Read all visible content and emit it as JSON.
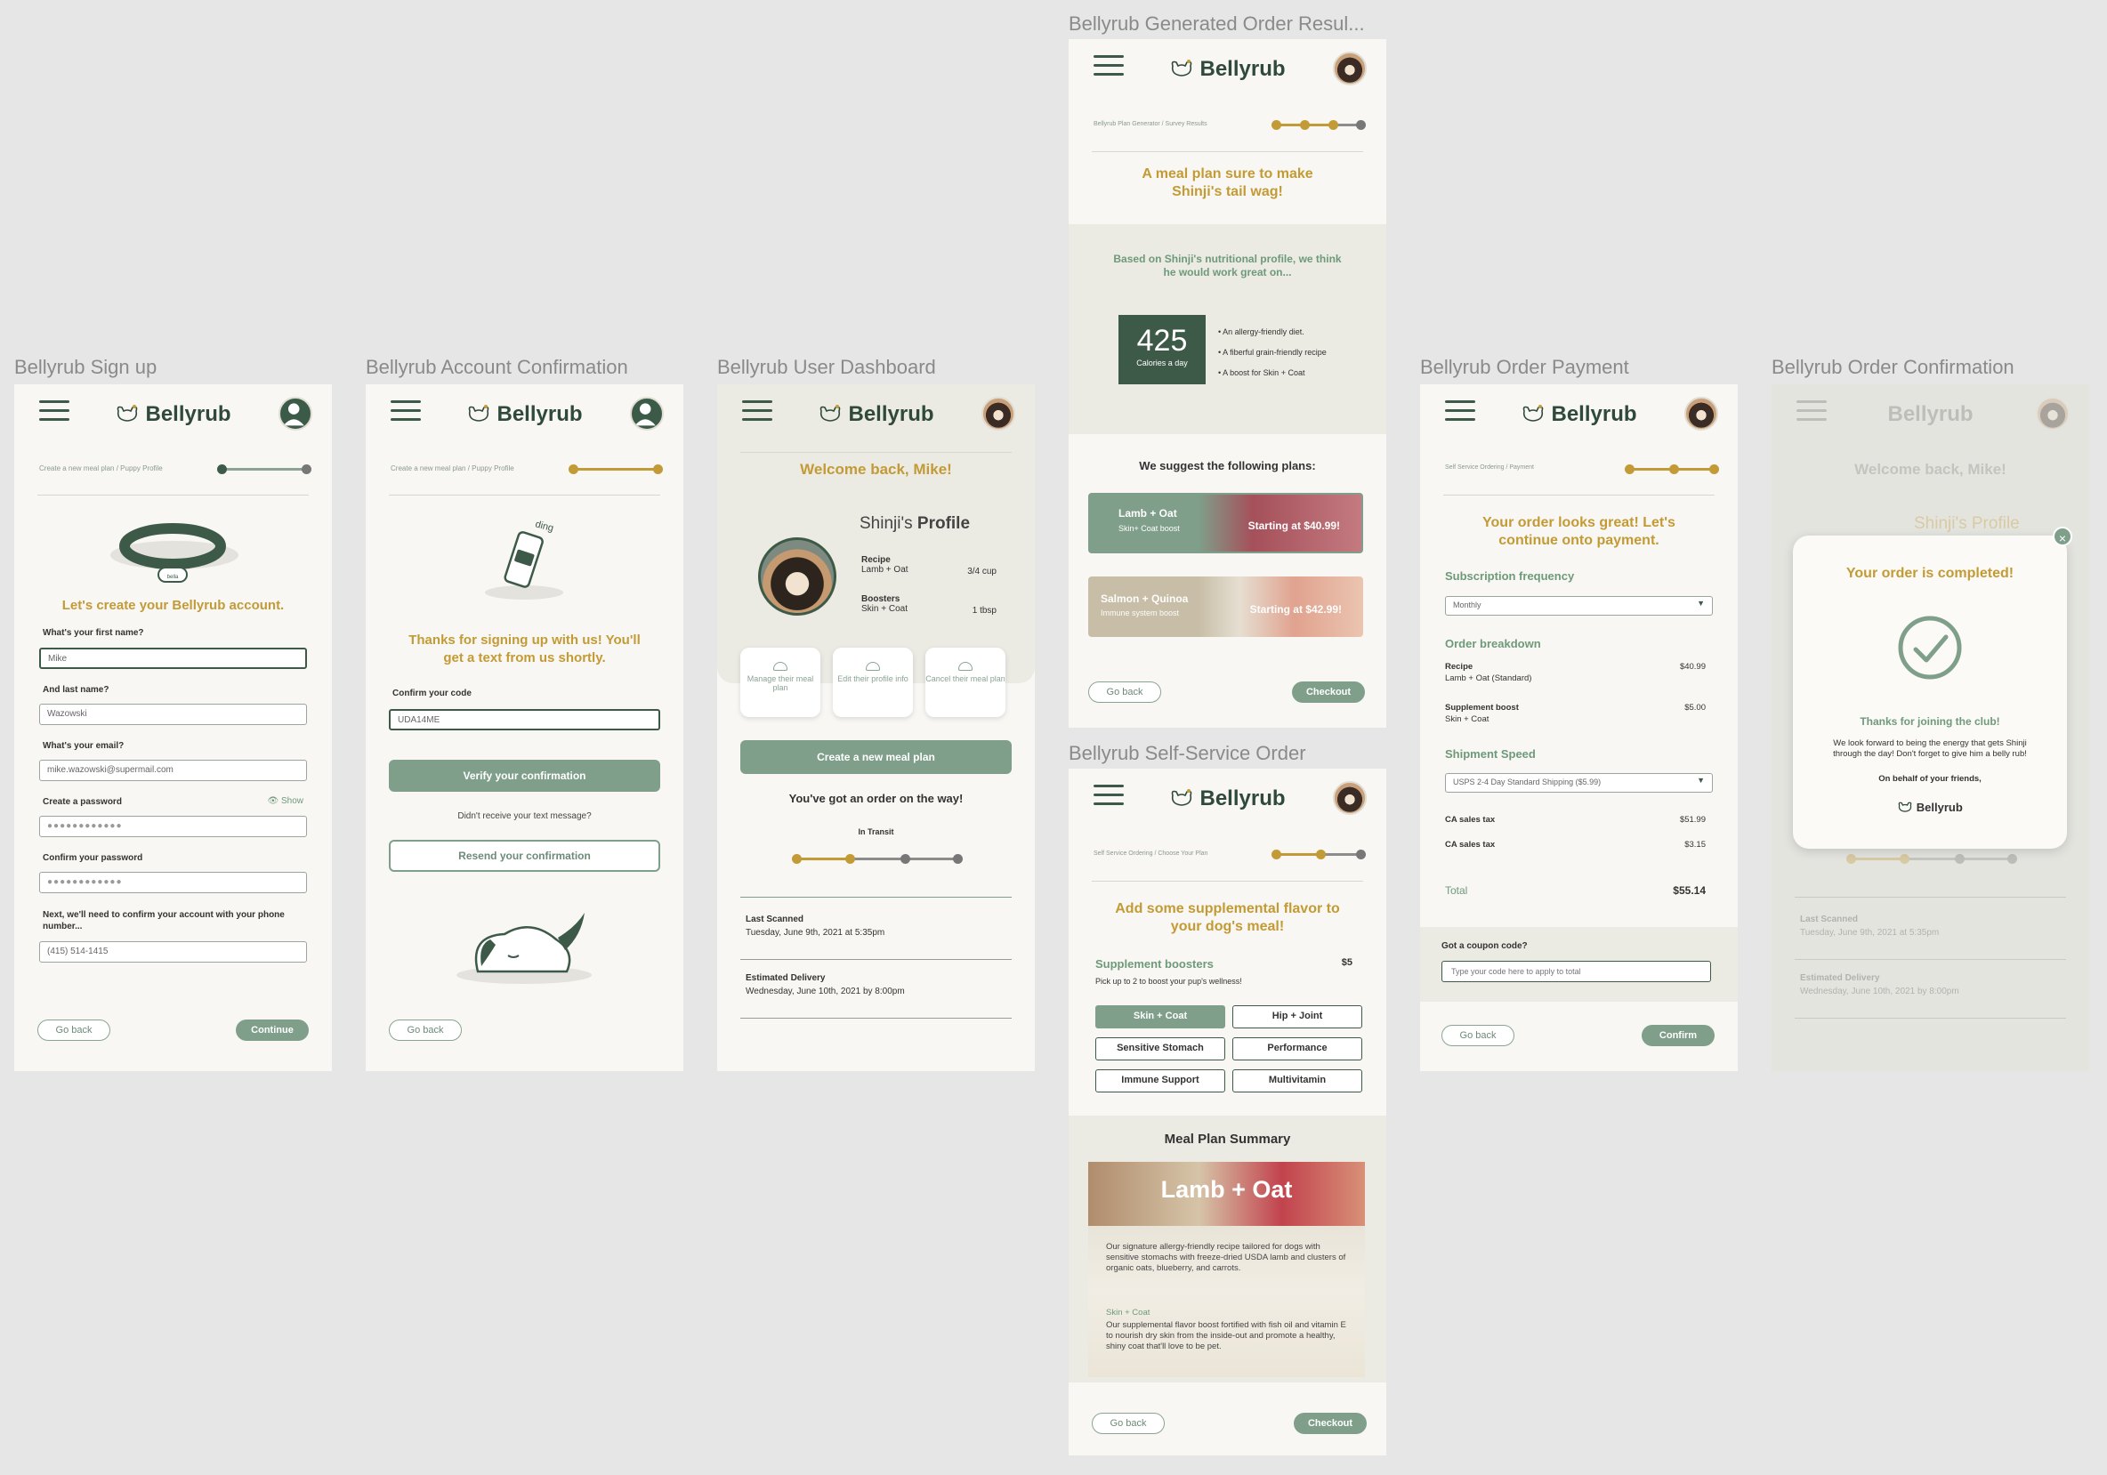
{
  "brand": {
    "name": "Bellyrub",
    "green": "#3d5a48",
    "gold": "#c39b36",
    "sage": "#7f9f8a"
  },
  "frames": {
    "signup": {
      "label": "Bellyrub Sign up",
      "crumb": "Create a new meal plan / Puppy Profile",
      "heading": "Let's create your Bellyrub account.",
      "first_label": "What's your first name?",
      "first_value": "Mike",
      "last_label": "And last name?",
      "last_value": "Wazowski",
      "email_label": "What's your email?",
      "email_value": "mike.wazowski@supermail.com",
      "pw_label": "Create a password",
      "pw_show": "Show",
      "pw_value": "●●●●●●●●●●●●",
      "pw2_label": "Confirm your password",
      "pw2_value": "●●●●●●●●●●●●",
      "phone_label": "Next, we'll need to confirm your account with your phone number...",
      "phone_value": "(415) 514-1415",
      "back": "Go back",
      "continue": "Continue",
      "collar_tag": "bella"
    },
    "confirm": {
      "label": "Bellyrub Account Confirmation",
      "crumb": "Create a new meal plan / Puppy Profile",
      "ding": "ding",
      "heading": "Thanks for signing up with us! You'll get a text from us shortly.",
      "code_label": "Confirm your code",
      "code_value": "UDA14ME",
      "verify": "Verify your confirmation",
      "didnt": "Didn't receive your text message?",
      "resend": "Resend your confirmation",
      "back": "Go back"
    },
    "dashboard": {
      "label": "Bellyrub User Dashboard",
      "welcome": "Welcome back, Mike!",
      "profile_name": "Shinji's",
      "profile_word": "Profile",
      "recipe_label": "Recipe",
      "recipe_value": "Lamb + Oat",
      "recipe_amt": "3/4 cup",
      "boosters_label": "Boosters",
      "boosters_value": "Skin + Coat",
      "boosters_amt": "1 tbsp",
      "tiles": [
        "Manage their meal plan",
        "Edit their profile info",
        "Cancel their meal plan"
      ],
      "create": "Create a new meal plan",
      "order_msg": "You've got an order on the way!",
      "status": "In Transit",
      "last_scanned_label": "Last Scanned",
      "last_scanned_value": "Tuesday, June 9th, 2021 at 5:35pm",
      "est_label": "Estimated Delivery",
      "est_value": "Wednesday, June 10th, 2021 by 8:00pm"
    },
    "results": {
      "label": "Bellyrub Generated Order Resul...",
      "crumb": "Bellyrub Plan Generator  / Survey Results",
      "heading": "A meal plan sure to make Shinji's tail wag!",
      "based": "Based on Shinji's nutritional profile, we think he would work great on...",
      "calories": "425",
      "calories_label": "Calories a day",
      "bullets": [
        "An allergy-friendly diet.",
        "A fiberful grain-friendly recipe",
        "A boost for Skin + Coat"
      ],
      "suggest": "We suggest the following plans:",
      "plans": [
        {
          "name": "Lamb + Oat",
          "sub": "Skin+ Coat boost",
          "price": "Starting at $40.99!"
        },
        {
          "name": "Salmon + Quinoa",
          "sub": "Immune system boost",
          "price": "Starting at $42.99!"
        }
      ],
      "back": "Go back",
      "checkout": "Checkout"
    },
    "selfservice": {
      "label": "Bellyrub Self-Service Order",
      "crumb": "Self Service Ordering / Choose Your Plan",
      "heading": "Add some supplemental flavor to your dog's meal!",
      "boost_title": "Supplement boosters",
      "boost_price": "$5",
      "boost_sub": "Pick up to 2 to boost your pup's wellness!",
      "options": [
        "Skin + Coat",
        "Hip + Joint",
        "Sensitive Stomach",
        "Performance",
        "Immune Support",
        "Multivitamin"
      ],
      "summary_title": "Meal Plan Summary",
      "plan_name": "Lamb + Oat",
      "plan_desc": "Our signature allergy-friendly recipe tailored for dogs with sensitive stomachs with freeze-dried USDA lamb and clusters of organic oats, blueberry, and carrots.",
      "boost_name": "Skin + Coat",
      "boost_desc": "Our supplemental flavor boost fortified with fish oil and vitamin E to nourish dry skin from the inside-out and promote a healthy, shiny coat that'll love to be pet.",
      "back": "Go back",
      "checkout": "Checkout"
    },
    "payment": {
      "label": "Bellyrub Order Payment",
      "crumb": "Self Service Ordering / Payment",
      "heading": "Your order looks great! Let's continue onto payment.",
      "freq_title": "Subscription frequency",
      "freq_value": "Monthly",
      "breakdown_title": "Order breakdown",
      "recipe_label": "Recipe",
      "recipe_value": "Lamb + Oat (Standard)",
      "recipe_price": "$40.99",
      "supp_label": "Supplement boost",
      "supp_value": "Skin + Coat",
      "supp_price": "$5.00",
      "ship_title": "Shipment Speed",
      "ship_value": "USPS 2-4 Day Standard Shipping ($5.99)",
      "tax1_label": "CA sales tax",
      "tax1_value": "$51.99",
      "tax2_label": "CA sales tax",
      "tax2_value": "$3.15",
      "total_label": "Total",
      "total_value": "$55.14",
      "coupon_label": "Got a coupon code?",
      "coupon_placeholder": "Type your code here to apply to total",
      "back": "Go back",
      "confirm": "Confirm"
    },
    "orderconf": {
      "label": "Bellyrub Order Confirmation",
      "welcome": "Welcome back, Mike!",
      "profile": "Shinji's Profile",
      "modal_title": "Your order is completed!",
      "thanks": "Thanks for joining the club!",
      "body": "We look forward to being the energy that gets Shinji through the day! Don't forget to give him a belly rub!",
      "behalf": "On behalf of your friends,",
      "sign": "Bellyrub",
      "last_scanned_label": "Last Scanned",
      "last_scanned_value": "Tuesday, June 9th, 2021 at 5:35pm",
      "est_label": "Estimated Delivery",
      "est_value": "Wednesday, June 10th, 2021 by 8:00pm"
    }
  }
}
